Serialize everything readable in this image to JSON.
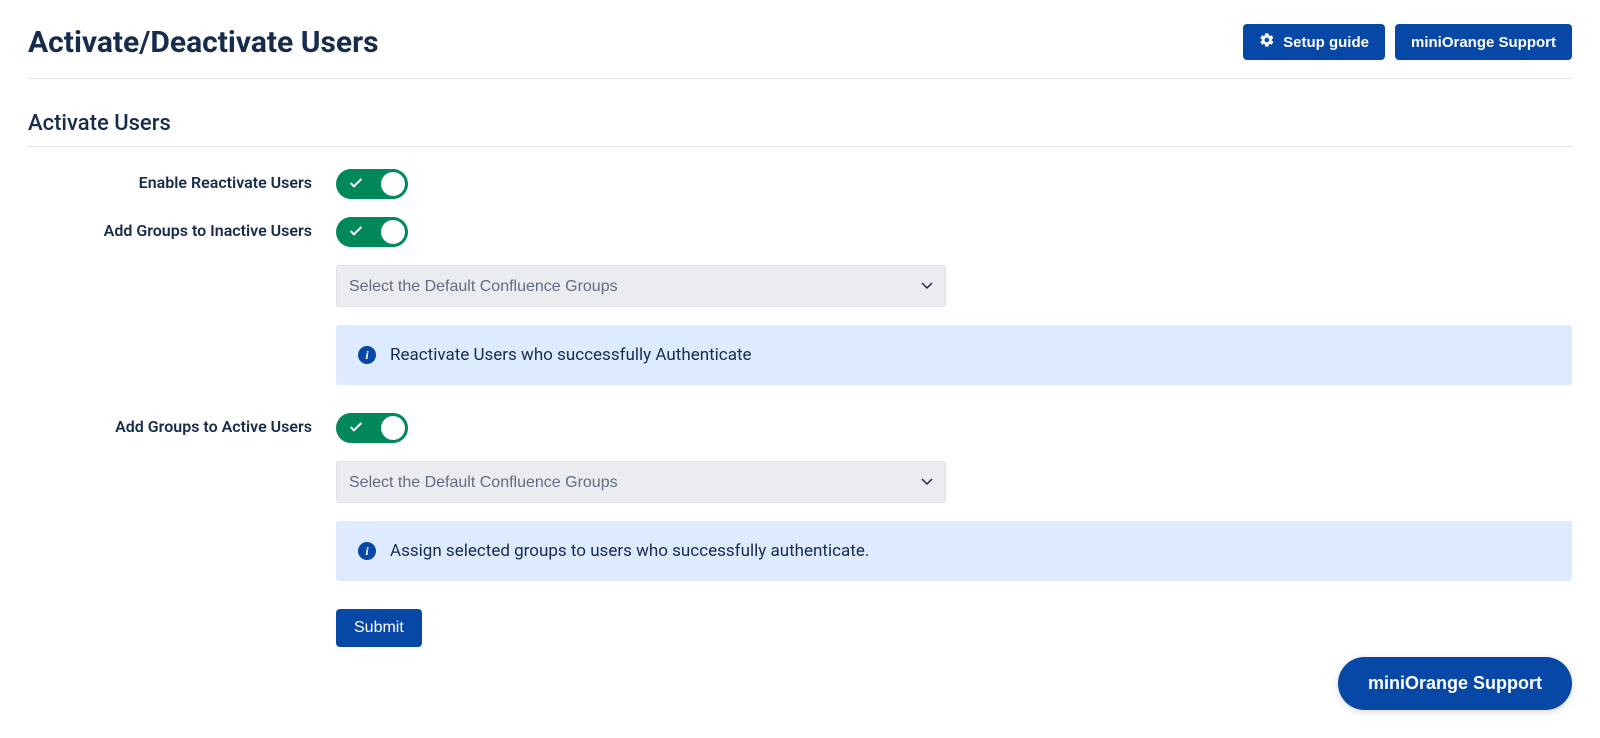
{
  "header": {
    "title": "Activate/Deactivate Users",
    "setup_guide_label": "Setup guide",
    "support_label": "miniOrange Support"
  },
  "section": {
    "title": "Activate Users"
  },
  "fields": {
    "enable_reactivate": {
      "label": "Enable Reactivate Users",
      "value": true
    },
    "add_groups_inactive": {
      "label": "Add Groups to Inactive Users",
      "value": true,
      "select_placeholder": "Select the Default Confluence Groups"
    },
    "info_reactivate": "Reactivate Users who successfully Authenticate",
    "add_groups_active": {
      "label": "Add Groups to Active Users",
      "value": true,
      "select_placeholder": "Select the Default Confluence Groups"
    },
    "info_assign": "Assign selected groups to users who successfully authenticate."
  },
  "submit_label": "Submit",
  "floating_support_label": "miniOrange Support"
}
